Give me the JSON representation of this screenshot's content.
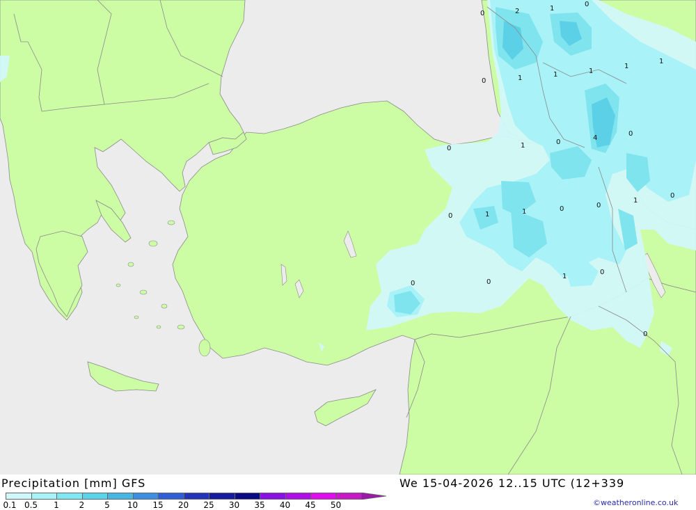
{
  "footer": {
    "title": "Precipitation [mm] GFS",
    "datetime": "We 15-04-2026 12..15 UTC (12+339",
    "credit": "©weatheronline.co.uk"
  },
  "legend": {
    "ticks": [
      "0.1",
      "0.5",
      "1",
      "2",
      "5",
      "10",
      "15",
      "20",
      "25",
      "30",
      "35",
      "40",
      "45",
      "50"
    ],
    "colors": [
      "#d0f8fa",
      "#a8f4f8",
      "#80e8f0",
      "#5ad4e8",
      "#46b6e2",
      "#3c8ee0",
      "#2e5ed6",
      "#2434b8",
      "#161a9c",
      "#0a0a84",
      "#8a10e6",
      "#b00ee8",
      "#e00cee",
      "#c818c8",
      "#9a1aa8"
    ]
  },
  "map": {
    "colors": {
      "sea": "#ececec",
      "land": "#ccfca4",
      "precip_light": "#d2f8fa",
      "precip_1": "#a8f2f8",
      "precip_2": "#80e4ee",
      "precip_5": "#5cd0e6",
      "border": "#8a8a8a"
    },
    "labels": [
      {
        "id": "lbl-01",
        "text": "0"
      },
      {
        "id": "lbl-02",
        "text": "2"
      },
      {
        "id": "lbl-03",
        "text": "1"
      },
      {
        "id": "lbl-04",
        "text": "0"
      },
      {
        "id": "lbl-05",
        "text": "0"
      },
      {
        "id": "lbl-06",
        "text": "1"
      },
      {
        "id": "lbl-07",
        "text": "1"
      },
      {
        "id": "lbl-08",
        "text": "1"
      },
      {
        "id": "lbl-09",
        "text": "1"
      },
      {
        "id": "lbl-10",
        "text": "1"
      },
      {
        "id": "lbl-11",
        "text": "0"
      },
      {
        "id": "lbl-12",
        "text": "1"
      },
      {
        "id": "lbl-13",
        "text": "0"
      },
      {
        "id": "lbl-14",
        "text": "4"
      },
      {
        "id": "lbl-15",
        "text": "0"
      },
      {
        "id": "lbl-16",
        "text": "1"
      },
      {
        "id": "lbl-17",
        "text": "0"
      },
      {
        "id": "lbl-18",
        "text": "0"
      },
      {
        "id": "lbl-19",
        "text": "1"
      },
      {
        "id": "lbl-20",
        "text": "1"
      },
      {
        "id": "lbl-21",
        "text": "0"
      },
      {
        "id": "lbl-22",
        "text": "0"
      },
      {
        "id": "lbl-23",
        "text": "0"
      },
      {
        "id": "lbl-24",
        "text": "0"
      },
      {
        "id": "lbl-25",
        "text": "1"
      },
      {
        "id": "lbl-26",
        "text": "0"
      },
      {
        "id": "lbl-27",
        "text": "0"
      }
    ]
  }
}
